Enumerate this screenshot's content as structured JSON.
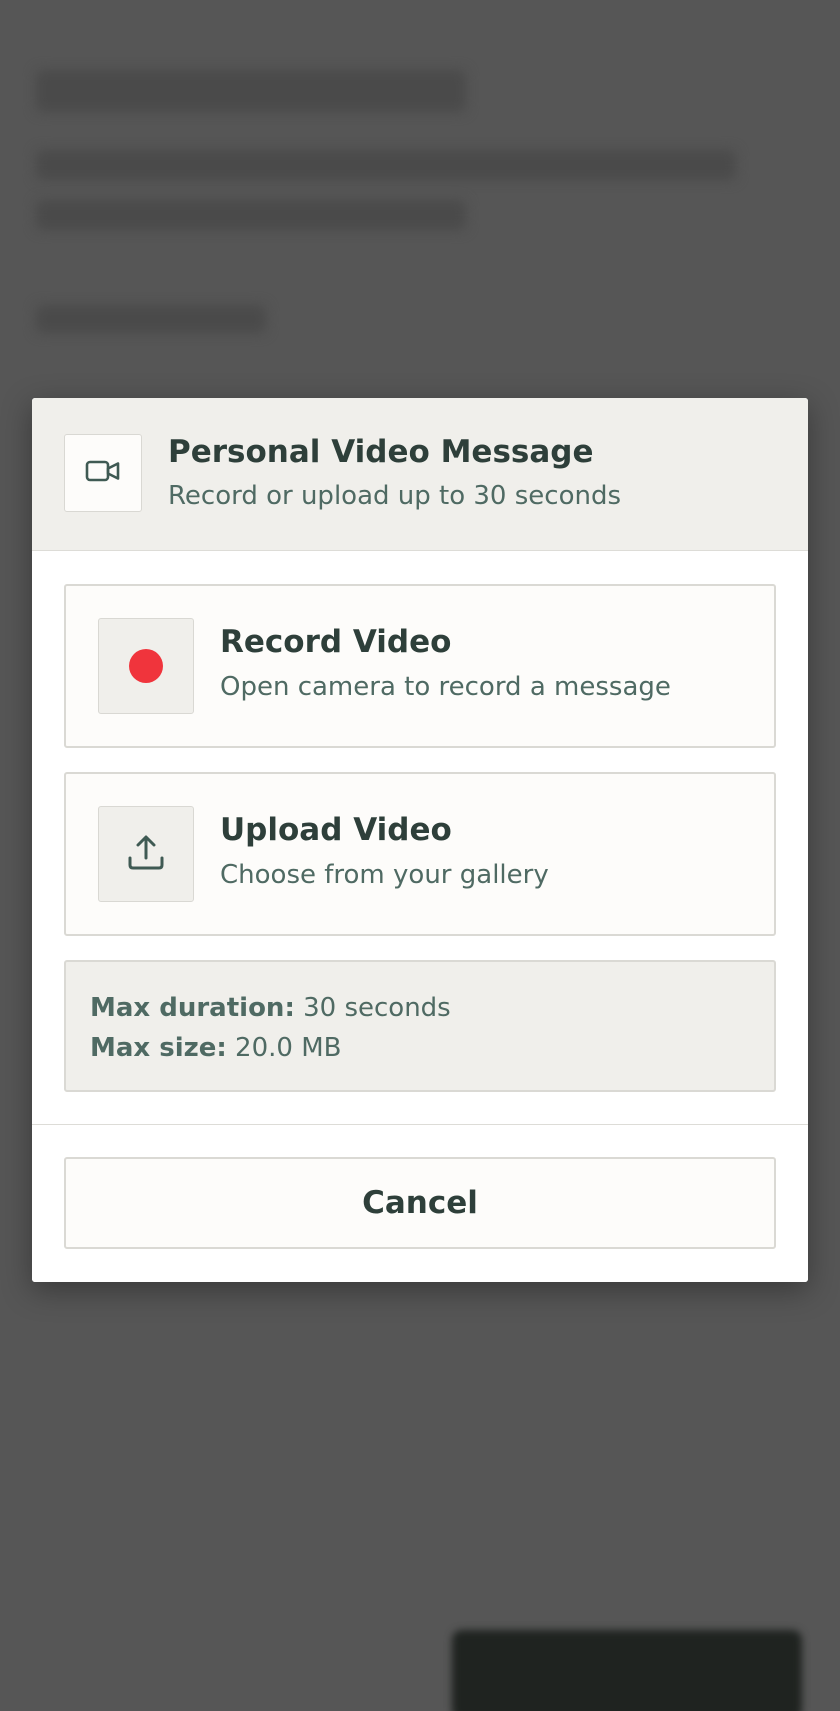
{
  "modal": {
    "title": "Personal Video Message",
    "subtitle": "Record or upload up to 30 seconds",
    "header_icon": "video-camera-icon"
  },
  "options": [
    {
      "title": "Record Video",
      "description": "Open camera to record a message",
      "icon": "record-dot-icon",
      "icon_color": "#f0343c"
    },
    {
      "title": "Upload Video",
      "description": "Choose from your gallery",
      "icon": "upload-icon"
    }
  ],
  "limits": {
    "duration_label": "Max duration:",
    "duration_value": " 30 seconds",
    "size_label": "Max size:",
    "size_value": " 20.0 MB"
  },
  "footer": {
    "cancel_label": "Cancel"
  },
  "colors": {
    "text_primary": "#2e3f3a",
    "text_secondary": "#4f6a63",
    "header_bg": "#f0efeb",
    "overlay": "#565656"
  }
}
